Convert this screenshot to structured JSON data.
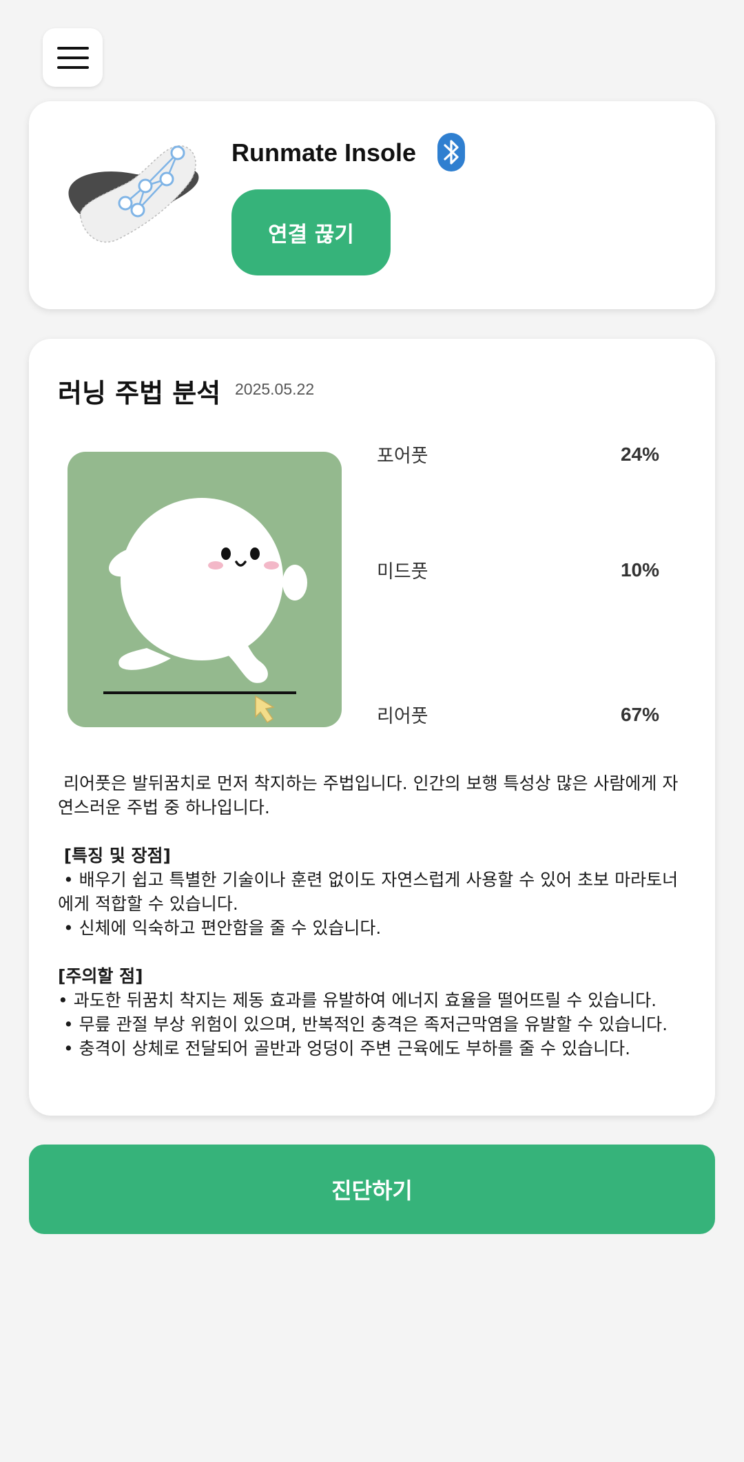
{
  "header": {
    "menu_icon": "hamburger-menu-icon"
  },
  "device": {
    "name": "Runmate Insole",
    "status_icon": "bluetooth-icon",
    "disconnect_label": "연결 끊기",
    "accent_color": "#36b37a",
    "bluetooth_color": "#2f7fd0"
  },
  "analysis": {
    "title": "러닝 주법 분석",
    "date": "2025.05.22",
    "stats": [
      {
        "label": "포어풋",
        "value": "24%"
      },
      {
        "label": "미드풋",
        "value": "10%"
      },
      {
        "label": "리어풋",
        "value": "67%"
      }
    ],
    "description": {
      "intro": " 리어풋은 발뒤꿈치로 먼저 착지하는 주법입니다. 인간의 보행 특성상 많은 사람에게 자연스러운 주법 중 하나입니다.",
      "pros_heading": " [특징 및 장점]",
      "pros": [
        " • 배우기 쉽고 특별한 기술이나 훈련 없이도 자연스럽게 사용할 수 있어 초보 마라토너에게 적합할 수 있습니다.",
        " • 신체에 익숙하고 편안함을 줄 수 있습니다."
      ],
      "cautions_heading": "[주의할 점]",
      "cautions": [
        "• 과도한 뒤꿈치 착지는 제동 효과를 유발하여 에너지 효율을 떨어뜨릴 수 있습니다.",
        " • 무릎 관절 부상 위험이 있으며, 반복적인 충격은 족저근막염을 유발할 수 있습니다.",
        " • 충격이 상체로 전달되어 골반과 엉덩이 주변 근육에도 부하를 줄 수 있습니다."
      ]
    }
  },
  "actions": {
    "diagnose_label": "진단하기"
  }
}
